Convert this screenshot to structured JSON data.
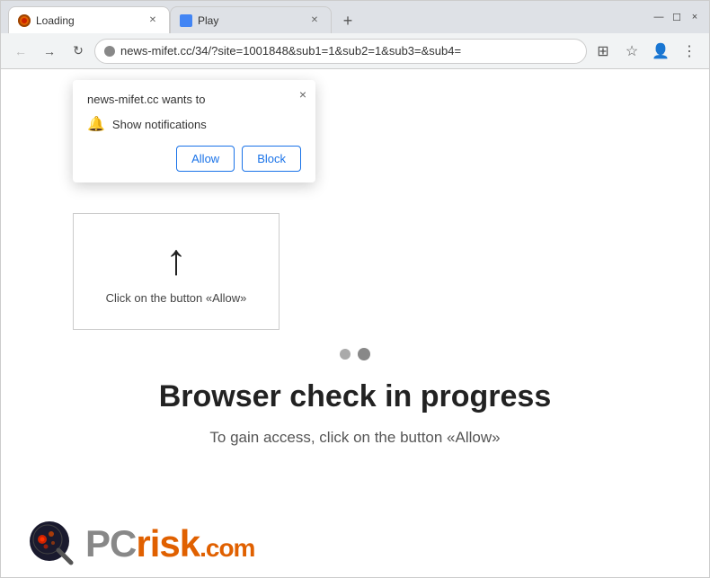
{
  "browser": {
    "tabs": [
      {
        "id": "loading",
        "title": "Loading",
        "favicon": "loading",
        "active": true
      },
      {
        "id": "play",
        "title": "Play",
        "favicon": "play",
        "active": false
      }
    ],
    "new_tab_label": "+",
    "window_controls": [
      "minimize",
      "maximize",
      "close"
    ],
    "url": "news-mifet.cc/34/?site=1001848&sub1=1&sub2=1&sub3=&sub4=",
    "nav_back": "←",
    "nav_forward": "→",
    "nav_refresh": "↻"
  },
  "notification_popup": {
    "title": "news-mifet.cc wants to",
    "notification_row": "Show notifications",
    "allow_label": "Allow",
    "block_label": "Block",
    "close_label": "×"
  },
  "arrow_box": {
    "label": "Click on the button «Allow»"
  },
  "main_content": {
    "heading": "Browser check in progress",
    "subheading": "To gain access, click on the button «Allow»"
  },
  "pcrisk": {
    "text_pc": "PC",
    "text_risk": "risk",
    "text_com": ".com"
  },
  "icons": {
    "bell": "🔔",
    "back": "←",
    "forward": "→",
    "refresh": "↻",
    "security": "🔒",
    "grid": "⊞",
    "star": "☆",
    "profile": "👤",
    "menu": "⋮",
    "minimize": "—",
    "maximize": "☐",
    "close": "×"
  }
}
